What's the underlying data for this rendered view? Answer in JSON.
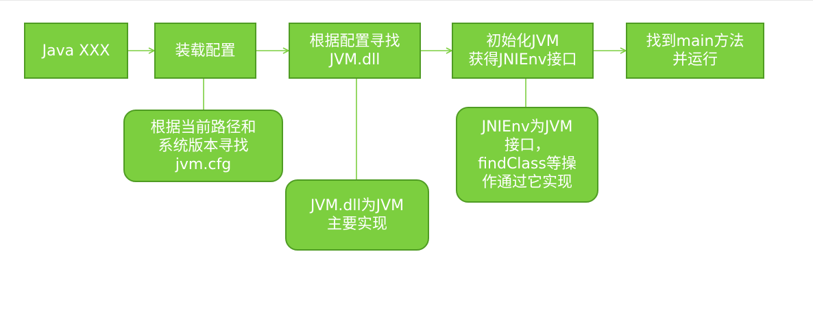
{
  "steps": [
    {
      "label": "Java XXX"
    },
    {
      "label": "装载配置"
    },
    {
      "label": "根据配置寻找\nJVM.dll"
    },
    {
      "label": "初始化JVM\n获得JNIEnv接口"
    },
    {
      "label": "找到main方法\n并运行"
    }
  ],
  "notes": [
    {
      "label": "根据当前路径和\n系统版本寻找\njvm.cfg"
    },
    {
      "label": "JVM.dll为JVM\n主要实现"
    },
    {
      "label": "JNIEnv为JVM\n接口，\nfindClass等操\n作通过它实现"
    }
  ],
  "colors": {
    "box_fill": "#7ccf3f",
    "box_border": "#4f9c23",
    "connector": "#7ccf3f"
  }
}
